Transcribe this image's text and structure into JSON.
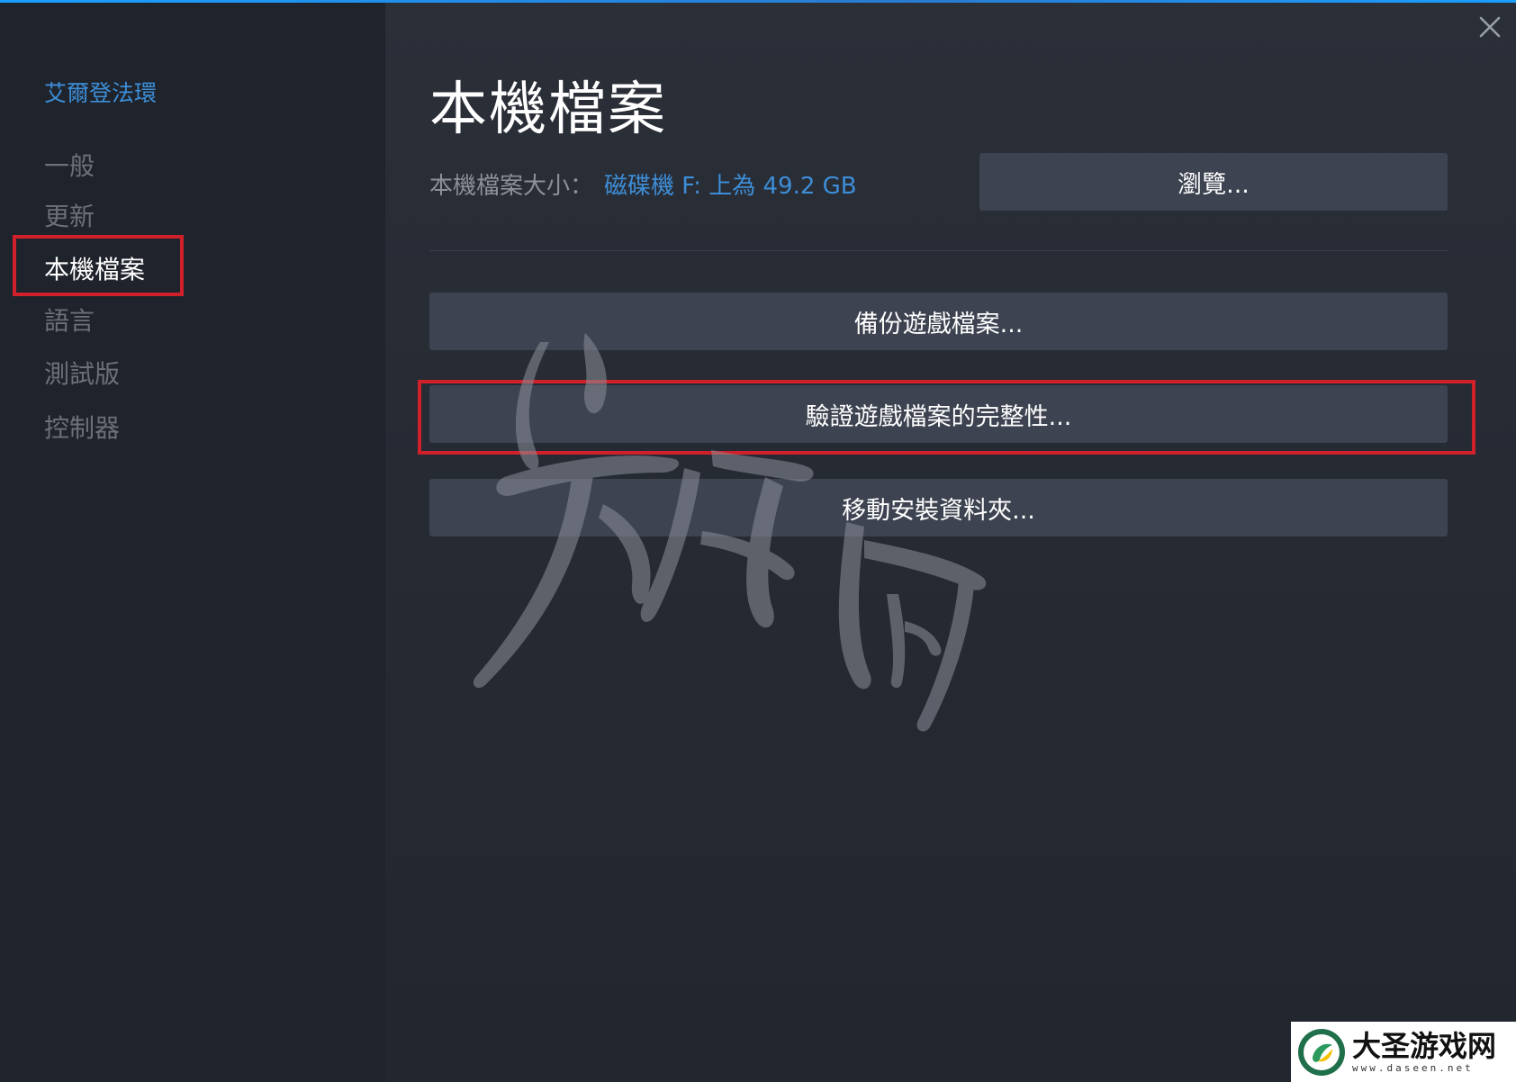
{
  "sidebar": {
    "game_title": "艾爾登法環",
    "items": [
      {
        "label": "一般"
      },
      {
        "label": "更新"
      },
      {
        "label": "本機檔案",
        "active": true
      },
      {
        "label": "語言"
      },
      {
        "label": "測試版"
      },
      {
        "label": "控制器"
      }
    ]
  },
  "main": {
    "title": "本機檔案",
    "size_label": "本機檔案大小：",
    "size_value": "磁碟機 F: 上為 49.2 GB",
    "browse_label": "瀏覽...",
    "buttons": {
      "backup": "備份遊戲檔案...",
      "verify": "驗證遊戲檔案的完整性...",
      "move": "移動安裝資料夾..."
    }
  },
  "logo": {
    "name": "大圣游戏网",
    "url": "www.daseen.net"
  },
  "colors": {
    "accent_blue": "#3d8ed8",
    "highlight_red": "#d0202a",
    "button_bg": "#3d4350"
  }
}
